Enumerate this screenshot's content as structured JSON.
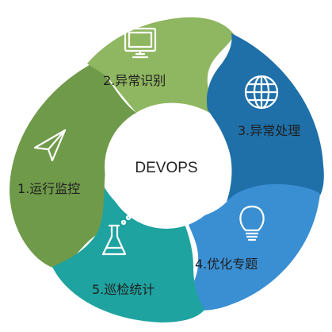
{
  "center": {
    "label": "DEVOPS"
  },
  "stages": [
    {
      "key": "monitor",
      "label": "1.运行监控",
      "color": "#6f9a4a",
      "icon": "paper-plane-icon"
    },
    {
      "key": "detect",
      "label": "2.异常识别",
      "color": "#8fb660",
      "icon": "monitor-icon"
    },
    {
      "key": "handle",
      "label": "3.异常处理",
      "color": "#1f6fa9",
      "icon": "globe-icon"
    },
    {
      "key": "optimize",
      "label": "4.优化专题",
      "color": "#3a8fd3",
      "icon": "lightbulb-icon"
    },
    {
      "key": "inspect",
      "label": "5.巡检统计",
      "color": "#1fa3a0",
      "icon": "flask-icon"
    }
  ]
}
